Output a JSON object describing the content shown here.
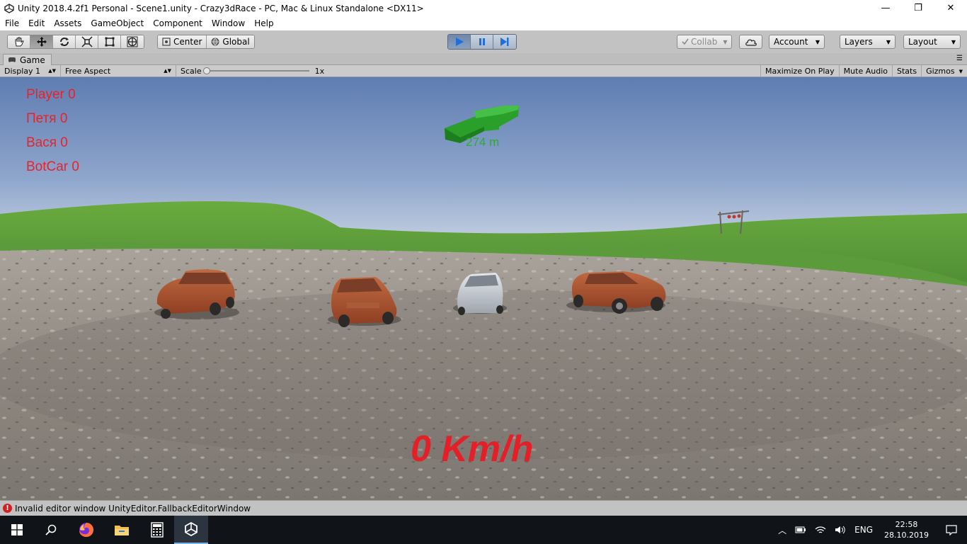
{
  "window": {
    "title": "Unity 2018.4.2f1 Personal - Scene1.unity - Crazy3dRace - PC, Mac & Linux Standalone <DX11>",
    "minimize": "—",
    "maximize": "❐",
    "close": "✕"
  },
  "menu": [
    "File",
    "Edit",
    "Assets",
    "GameObject",
    "Component",
    "Window",
    "Help"
  ],
  "toolbar": {
    "tools": [
      "hand-tool",
      "move-tool",
      "rotate-tool",
      "scale-tool",
      "rect-tool",
      "transform-tool"
    ],
    "active_tool": "move-tool",
    "pivot": "Center",
    "space": "Global",
    "play_active": true,
    "collab": "Collab",
    "account": "Account",
    "layers": "Layers",
    "layout": "Layout"
  },
  "game_tab": {
    "label": "Game",
    "display": "Display 1",
    "aspect": "Free Aspect",
    "scale_label": "Scale",
    "scale_value": "1x",
    "maximize_on_play": "Maximize On Play",
    "mute_audio": "Mute Audio",
    "stats": "Stats",
    "gizmos": "Gizmos"
  },
  "hud": {
    "scores": [
      "Player  0",
      "Петя 0",
      "Вася 0",
      "BotCar 0"
    ],
    "distance": "274 m",
    "speed": "0 Km/h"
  },
  "status": {
    "message": "Invalid editor window UnityEditor.FallbackEditorWindow"
  },
  "taskbar": {
    "apps": [
      "windows-start",
      "search",
      "firefox",
      "file-explorer",
      "calculator",
      "unity"
    ],
    "language": "ENG",
    "time": "22:58",
    "date": "28.10.2019"
  },
  "colors": {
    "hud_red": "#e41f27",
    "arrow_green": "#27b02a",
    "sky_top": "#6a86b8",
    "grass": "#5f9e3c"
  }
}
